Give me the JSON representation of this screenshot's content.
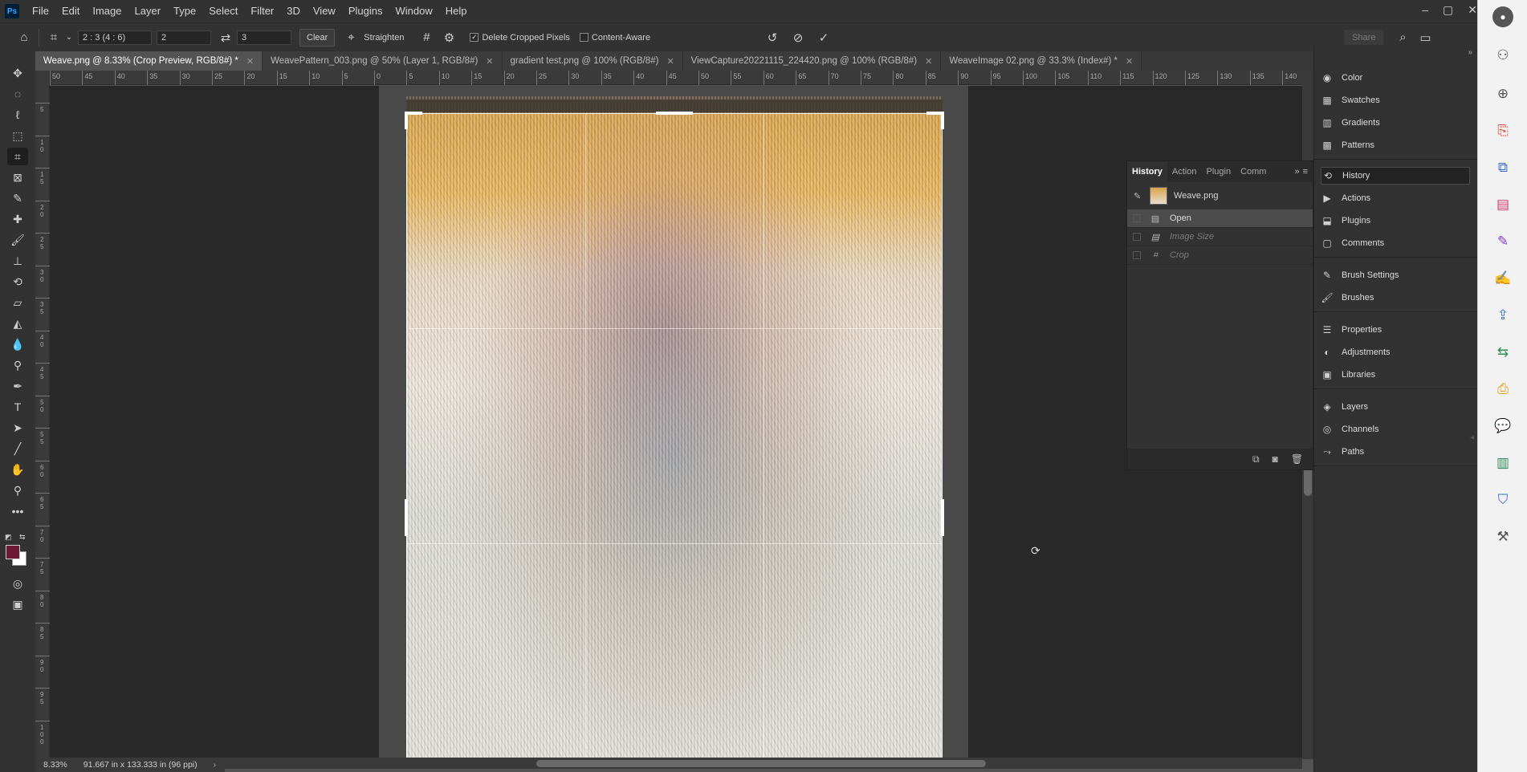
{
  "menubar": {
    "logo": "Ps",
    "items": [
      "File",
      "Edit",
      "Image",
      "Layer",
      "Type",
      "Select",
      "Filter",
      "3D",
      "View",
      "Plugins",
      "Window",
      "Help"
    ],
    "window_controls": [
      "–",
      "▢",
      "✕"
    ]
  },
  "options": {
    "ratio_preset": "2 : 3 (4 : 6)",
    "ratio_w": "2",
    "ratio_h": "3",
    "clear_label": "Clear",
    "straighten_label": "Straighten",
    "delete_cropped_label": "Delete Cropped Pixels",
    "content_aware_label": "Content-Aware",
    "share_label": "Share"
  },
  "tabs": [
    {
      "label": "Weave.png @ 8.33% (Crop Preview, RGB/8#) *",
      "active": true
    },
    {
      "label": "WeavePattern_003.png @ 50% (Layer 1, RGB/8#)",
      "active": false
    },
    {
      "label": "gradient test.png @ 100% (RGB/8#)",
      "active": false
    },
    {
      "label": "ViewCapture20221115_224420.png @ 100% (RGB/8#)",
      "active": false
    },
    {
      "label": "WeaveImage 02.png @ 33.3% (Index#) *",
      "active": false
    }
  ],
  "ruler_top_labels": [
    "50",
    "45",
    "40",
    "35",
    "30",
    "25",
    "20",
    "15",
    "10",
    "5",
    "0",
    "5",
    "10",
    "15",
    "20",
    "25",
    "30",
    "35",
    "40",
    "45",
    "50",
    "55",
    "60",
    "65",
    "70",
    "75",
    "80",
    "85",
    "90",
    "95",
    "100",
    "105",
    "110",
    "115",
    "120",
    "125",
    "130",
    "135",
    "140"
  ],
  "ruler_left_labels": [
    "5",
    "1 0",
    "1 5",
    "2 0",
    "2 5",
    "3 0",
    "3 5",
    "4 0",
    "4 5",
    "5 0",
    "5 5",
    "6 0",
    "6 5",
    "7 0",
    "7 5",
    "8 0",
    "8 5",
    "9 0",
    "9 5",
    "1 0 0"
  ],
  "status": {
    "zoom": "8.33%",
    "doc_info": "91.667 in x 133.333 in (96 ppi)"
  },
  "history_panel": {
    "tabs": [
      "History",
      "Action",
      "Plugin",
      "Comm"
    ],
    "snapshot": "Weave.png",
    "states": [
      {
        "label": "Open",
        "selected": true,
        "dim": false
      },
      {
        "label": "Image Size",
        "selected": false,
        "dim": true
      },
      {
        "label": "Crop",
        "selected": false,
        "dim": true
      }
    ]
  },
  "dock": {
    "items": [
      {
        "label": "Color",
        "icon": "color-icon"
      },
      {
        "label": "Swatches",
        "icon": "swatches-icon"
      },
      {
        "label": "Gradients",
        "icon": "gradients-icon"
      },
      {
        "label": "Patterns",
        "icon": "patterns-icon"
      },
      {
        "label": "History",
        "icon": "history-icon"
      },
      {
        "label": "Actions",
        "icon": "actions-icon"
      },
      {
        "label": "Plugins",
        "icon": "plugins-icon"
      },
      {
        "label": "Comments",
        "icon": "comments-icon"
      },
      {
        "label": "Brush Settings",
        "icon": "brush-settings-icon"
      },
      {
        "label": "Brushes",
        "icon": "brushes-icon"
      },
      {
        "label": "Properties",
        "icon": "properties-icon"
      },
      {
        "label": "Adjustments",
        "icon": "adjustments-icon"
      },
      {
        "label": "Libraries",
        "icon": "libraries-icon"
      },
      {
        "label": "Layers",
        "icon": "layers-icon"
      },
      {
        "label": "Channels",
        "icon": "channels-icon"
      },
      {
        "label": "Paths",
        "icon": "paths-icon"
      }
    ]
  },
  "colors": {
    "foreground": "#6b1a35",
    "background": "#ffffff",
    "accent": "#31a8ff"
  }
}
